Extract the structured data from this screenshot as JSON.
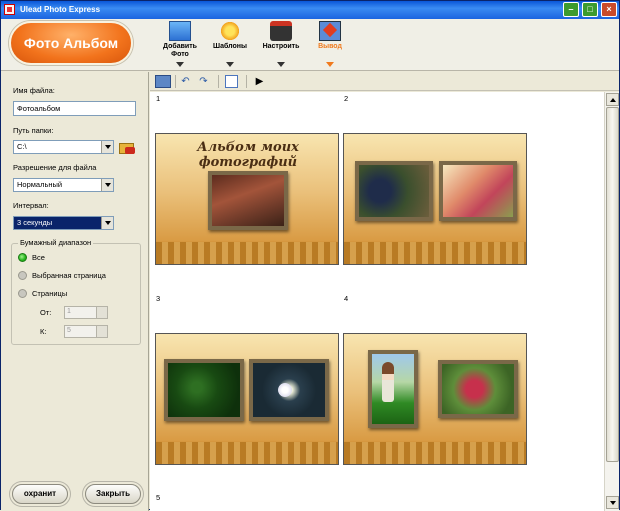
{
  "window": {
    "title": "Ulead Photo Express"
  },
  "toolbar": {
    "logo_label": "Фото Альбом",
    "items": [
      {
        "label": "Добавить Фото",
        "icon": "monitor-icon"
      },
      {
        "label": "Шаблоны",
        "icon": "sun-icon"
      },
      {
        "label": "Настроить",
        "icon": "toolbox-icon"
      },
      {
        "label": "Вывод",
        "icon": "output-icon",
        "active": true
      }
    ],
    "active_color": "#F07A1E"
  },
  "left_panel": {
    "filename_label": "Имя файла:",
    "filename_value": "Фотоальбом",
    "folder_label": "Путь папки:",
    "folder_value": "C:\\",
    "resolution_label": "Разрешение для файла",
    "resolution_value": "Нормальный",
    "interval_label": "Интервал:",
    "interval_value": "3 секунды",
    "range_group": {
      "title": "Бумажный диапазон",
      "all_label": "Все",
      "selected_page_label": "Выбранная страница",
      "pages_label": "Страницы",
      "from_label": "От:",
      "from_value": "1",
      "to_label": "К:",
      "to_value": "5",
      "selected": "all"
    },
    "save_label": "охранит",
    "close_label": "Закрыть"
  },
  "pages": [
    {
      "number": "1",
      "title": "Альбом моих фотографий"
    },
    {
      "number": "2"
    },
    {
      "number": "3"
    },
    {
      "number": "4"
    },
    {
      "number": "5"
    }
  ]
}
